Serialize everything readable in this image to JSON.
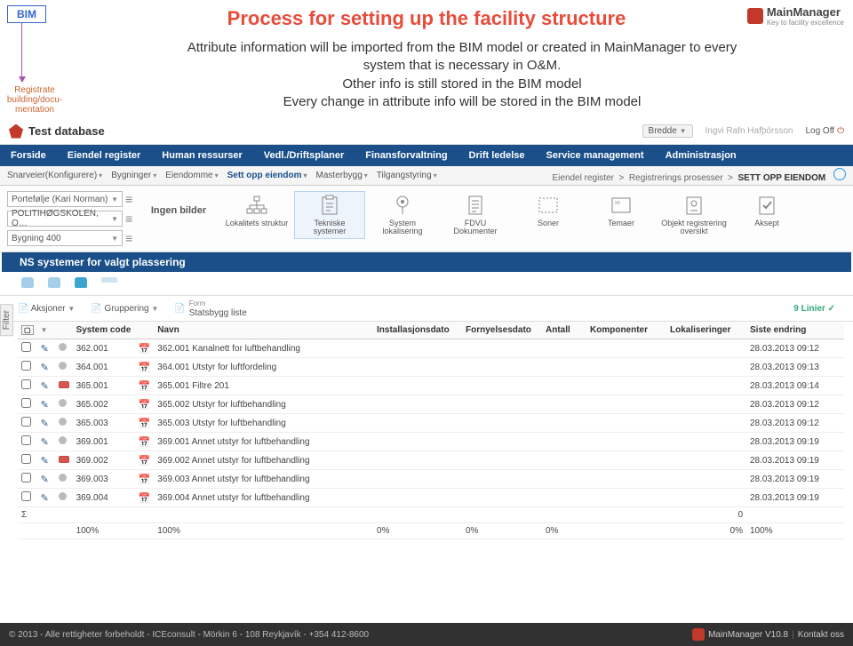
{
  "slide": {
    "bim": "BIM",
    "reg": "Registrate building/docu-mentation",
    "title": "Process for setting up the facility structure",
    "body1": "Attribute information will be imported from the BIM model or created in MainManager to every system that is necessary in O&M.",
    "body2": "Other info is still stored in the BIM model",
    "body3": "Every change in attribute info will be stored in the BIM model",
    "logo_main": "MainManager",
    "logo_sub": "Key to facility excellence"
  },
  "topbar": {
    "db": "Test database",
    "bredde": "Bredde",
    "user": "Ingvi Rafn Hafþórsson",
    "logoff": "Log Off"
  },
  "mainnav": [
    "Forside",
    "Eiendel register",
    "Human ressurser",
    "Vedl./Driftsplaner",
    "Finansforvaltning",
    "Drift ledelse",
    "Service management",
    "Administrasjon"
  ],
  "subnav": {
    "items": [
      "Snarveier(Konfigurere)",
      "Bygninger",
      "Eiendomme",
      "Sett opp eiendom",
      "Masterbygg",
      "Tilgangstyring"
    ],
    "crumb1": "Eiendel register",
    "crumb2": "Registrerings prosesser",
    "crumb3": "SETT OPP EIENDOM"
  },
  "filters": {
    "f1": "Portefølje (Kari Norman)",
    "f2": "POLITIHØGSKOLEN, O…",
    "f3": "Bygning 400"
  },
  "ingen": "Ingen bilder",
  "cards": [
    {
      "label": "Lokalitets struktur",
      "icon": "tree"
    },
    {
      "label": "Tekniske systemer",
      "icon": "clipboard",
      "active": true
    },
    {
      "label": "System lokalisering",
      "icon": "pin"
    },
    {
      "label": "FDVU Dokumenter",
      "icon": "doc"
    },
    {
      "label": "Soner",
      "icon": "zone"
    },
    {
      "label": "Temaer",
      "icon": "theme"
    },
    {
      "label": "Objekt registrering oversikt",
      "icon": "obj"
    },
    {
      "label": "Aksept",
      "icon": "accept"
    }
  ],
  "filter_side": "Filter",
  "panel_title": "NS systemer for valgt plassering",
  "actionbar": {
    "aksjoner": "Aksjoner",
    "gruppering": "Gruppering",
    "form": "Form",
    "formval": "Statsbygg liste",
    "lines": "9 Linier"
  },
  "columns": [
    "",
    "",
    "",
    "System code",
    "",
    "Navn",
    "Installasjonsdato",
    "Fornyelsesdato",
    "Antall",
    "Komponenter",
    "Lokaliseringer",
    "Siste endring"
  ],
  "rows": [
    {
      "code": "362.001",
      "dot": "grey",
      "navn": "362.001 Kanalnett for luftbehandling",
      "d": "28.03.2013 09:12"
    },
    {
      "code": "364.001",
      "dot": "grey",
      "navn": "364.001 Utstyr for luftfordeling",
      "d": "28.03.2013 09:13"
    },
    {
      "code": "365.001",
      "dot": "red",
      "navn": "365.001 Filtre 201",
      "d": "28.03.2013 09:14"
    },
    {
      "code": "365.002",
      "dot": "grey",
      "navn": "365.002 Utstyr for luftbehandling",
      "d": "28.03.2013 09:12"
    },
    {
      "code": "365.003",
      "dot": "grey",
      "navn": "365.003 Utstyr for luftbehandling",
      "d": "28.03.2013 09:12"
    },
    {
      "code": "369.001",
      "dot": "grey",
      "navn": "369.001 Annet utstyr for luftbehandling",
      "d": "28.03.2013 09:19"
    },
    {
      "code": "369.002",
      "dot": "red",
      "navn": "369.002 Annet utstyr for luftbehandling",
      "d": "28.03.2013 09:19"
    },
    {
      "code": "369.003",
      "dot": "grey",
      "navn": "369.003 Annet utstyr for luftbehandling",
      "d": "28.03.2013 09:19"
    },
    {
      "code": "369.004",
      "dot": "grey",
      "navn": "369.004 Annet utstyr for luftbehandling",
      "d": "28.03.2013 09:19"
    }
  ],
  "sumrow": {
    "sigma": "Σ",
    "r1": "100%",
    "r2": "100%",
    "p0a": "0%",
    "p0b": "0%",
    "p0c": "0%",
    "zero": "0",
    "p0d": "0%",
    "p100": "100%"
  },
  "footer": {
    "copy": "© 2013 - Alle rettigheter forbeholdt - ICEconsult - Mörkin 6 - 108 Reykjavík - +354 412-8600",
    "ver": "MainManager V10.8",
    "contact": "Kontakt oss"
  }
}
